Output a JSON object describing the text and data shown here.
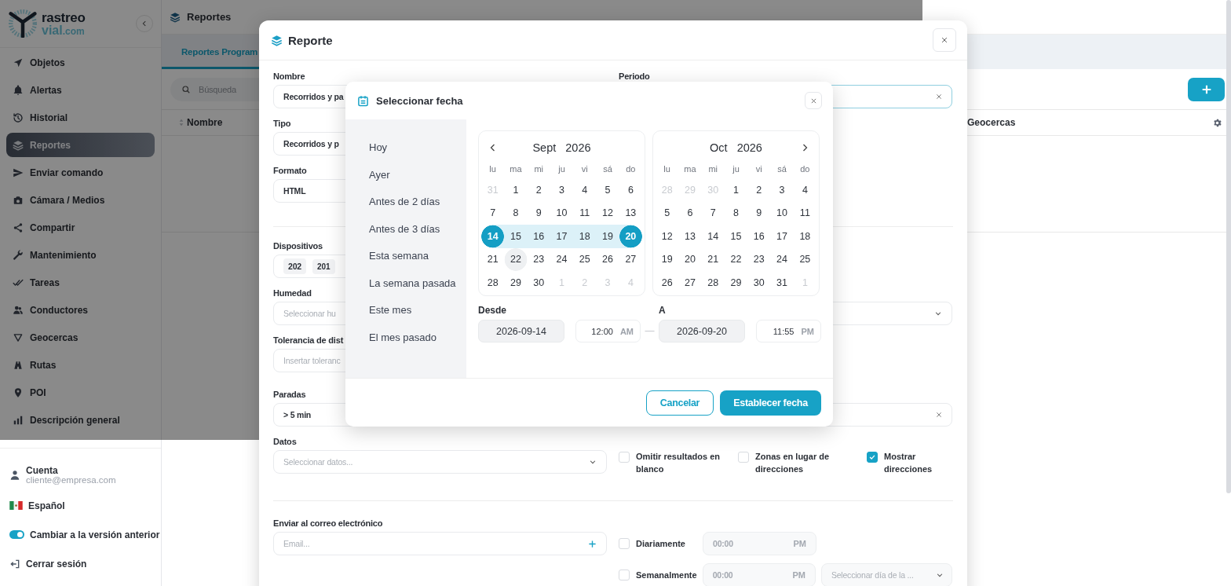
{
  "sidebar": {
    "brand": {
      "name": "rastreo",
      "domain": "vial",
      "tld": ".com"
    },
    "items": [
      {
        "label": "Objetos",
        "selected": false
      },
      {
        "label": "Alertas",
        "selected": false
      },
      {
        "label": "Historial",
        "selected": false
      },
      {
        "label": "Reportes",
        "selected": true
      },
      {
        "label": "Enviar comando",
        "selected": false
      },
      {
        "label": "Cámara / Medios",
        "selected": false
      },
      {
        "label": "Compartir",
        "selected": false
      },
      {
        "label": "Mantenimiento",
        "selected": false
      },
      {
        "label": "Tareas",
        "selected": false
      },
      {
        "label": "Conductores",
        "selected": false
      },
      {
        "label": "Geocercas",
        "selected": false
      },
      {
        "label": "Rutas",
        "selected": false
      },
      {
        "label": "POI",
        "selected": false
      },
      {
        "label": "Descripción general",
        "selected": false
      }
    ],
    "account": {
      "label": "Cuenta",
      "email": "cliente@empresa.com"
    },
    "language": "Español",
    "legacy_toggle": {
      "label": "Cambiar a la versión anterior",
      "on": true
    },
    "logout": "Cerrar sesión"
  },
  "page": {
    "title": "Reportes",
    "tabs": [
      {
        "label": "Reportes Program",
        "selected": true
      }
    ],
    "search": {
      "placeholder": "Búsqueda"
    },
    "table": {
      "columns": [
        "Nombre",
        "Geocercas"
      ]
    }
  },
  "report_dialog": {
    "title": "Reporte",
    "nombre": {
      "label": "Nombre",
      "value": "Recorridos y pa"
    },
    "periodo": {
      "label": "Periodo"
    },
    "tipo": {
      "label": "Tipo",
      "value": "Recorridos y p"
    },
    "formato": {
      "label": "Formato",
      "value": "HTML"
    },
    "dispositivos": {
      "label": "Dispositivos",
      "chips": [
        "202",
        "201"
      ]
    },
    "humedad": {
      "label": "Humedad",
      "placeholder": "Seleccionar hu"
    },
    "tolerancia": {
      "label": "Tolerancia de dist",
      "placeholder": "Insertar toleranc"
    },
    "paradas": {
      "label": "Paradas",
      "value": "> 5 min"
    },
    "datos": {
      "label": "Datos",
      "placeholder": "Seleccionar datos..."
    },
    "options": [
      {
        "label": "Omitir resultados en blanco",
        "checked": false
      },
      {
        "label": "Zonas en lugar de direcciones",
        "checked": false
      },
      {
        "label": "Mostrar direcciones",
        "checked": true
      }
    ],
    "email": {
      "label": "Enviar al correo electrónico",
      "placeholder": "Email..."
    },
    "schedule": [
      {
        "label": "Diariamente",
        "checked": false,
        "time": "00:00",
        "meridiem": "PM"
      },
      {
        "label": "Semanalmente",
        "checked": false,
        "time": "00:00",
        "meridiem": "PM",
        "day_placeholder": "Seleccionar día de la ..."
      }
    ]
  },
  "date_dialog": {
    "title": "Seleccionar fecha",
    "presets": [
      "Hoy",
      "Ayer",
      "Antes de 2 días",
      "Antes de 3 días",
      "Esta semana",
      "La semana pasada",
      "Este mes",
      "El mes pasado"
    ],
    "months": [
      {
        "month": "Sept",
        "year": "2026",
        "weekdays": [
          "lu",
          "ma",
          "mi",
          "ju",
          "vi",
          "sá",
          "do"
        ],
        "days": [
          {
            "label": "31",
            "muted": true,
            "selected": false,
            "in_range": false,
            "hovered": false
          },
          {
            "label": "1",
            "muted": false,
            "selected": false,
            "in_range": false,
            "hovered": false
          },
          {
            "label": "2",
            "muted": false,
            "selected": false,
            "in_range": false,
            "hovered": false
          },
          {
            "label": "3",
            "muted": false,
            "selected": false,
            "in_range": false,
            "hovered": false
          },
          {
            "label": "4",
            "muted": false,
            "selected": false,
            "in_range": false,
            "hovered": false
          },
          {
            "label": "5",
            "muted": false,
            "selected": false,
            "in_range": false,
            "hovered": false
          },
          {
            "label": "6",
            "muted": false,
            "selected": false,
            "in_range": false,
            "hovered": false
          },
          {
            "label": "7",
            "muted": false,
            "selected": false,
            "in_range": false,
            "hovered": false
          },
          {
            "label": "8",
            "muted": false,
            "selected": false,
            "in_range": false,
            "hovered": false
          },
          {
            "label": "9",
            "muted": false,
            "selected": false,
            "in_range": false,
            "hovered": false
          },
          {
            "label": "10",
            "muted": false,
            "selected": false,
            "in_range": false,
            "hovered": false
          },
          {
            "label": "11",
            "muted": false,
            "selected": false,
            "in_range": false,
            "hovered": false
          },
          {
            "label": "12",
            "muted": false,
            "selected": false,
            "in_range": false,
            "hovered": false
          },
          {
            "label": "13",
            "muted": false,
            "selected": false,
            "in_range": false,
            "hovered": false
          },
          {
            "label": "14",
            "muted": false,
            "selected": true,
            "in_range": false,
            "hovered": false
          },
          {
            "label": "15",
            "muted": false,
            "selected": false,
            "in_range": true,
            "hovered": false
          },
          {
            "label": "16",
            "muted": false,
            "selected": false,
            "in_range": true,
            "hovered": false
          },
          {
            "label": "17",
            "muted": false,
            "selected": false,
            "in_range": true,
            "hovered": false
          },
          {
            "label": "18",
            "muted": false,
            "selected": false,
            "in_range": true,
            "hovered": false
          },
          {
            "label": "19",
            "muted": false,
            "selected": false,
            "in_range": true,
            "hovered": false
          },
          {
            "label": "20",
            "muted": false,
            "selected": true,
            "in_range": false,
            "hovered": false
          },
          {
            "label": "21",
            "muted": false,
            "selected": false,
            "in_range": false,
            "hovered": false
          },
          {
            "label": "22",
            "muted": false,
            "selected": false,
            "in_range": false,
            "hovered": true
          },
          {
            "label": "23",
            "muted": false,
            "selected": false,
            "in_range": false,
            "hovered": false
          },
          {
            "label": "24",
            "muted": false,
            "selected": false,
            "in_range": false,
            "hovered": false
          },
          {
            "label": "25",
            "muted": false,
            "selected": false,
            "in_range": false,
            "hovered": false
          },
          {
            "label": "26",
            "muted": false,
            "selected": false,
            "in_range": false,
            "hovered": false
          },
          {
            "label": "27",
            "muted": false,
            "selected": false,
            "in_range": false,
            "hovered": false
          },
          {
            "label": "28",
            "muted": false,
            "selected": false,
            "in_range": false,
            "hovered": false
          },
          {
            "label": "29",
            "muted": false,
            "selected": false,
            "in_range": false,
            "hovered": false
          },
          {
            "label": "30",
            "muted": false,
            "selected": false,
            "in_range": false,
            "hovered": false
          },
          {
            "label": "1",
            "muted": true,
            "selected": false,
            "in_range": false,
            "hovered": false
          },
          {
            "label": "2",
            "muted": true,
            "selected": false,
            "in_range": false,
            "hovered": false
          },
          {
            "label": "3",
            "muted": true,
            "selected": false,
            "in_range": false,
            "hovered": false
          },
          {
            "label": "4",
            "muted": true,
            "selected": false,
            "in_range": false,
            "hovered": false
          }
        ]
      },
      {
        "month": "Oct",
        "year": "2026",
        "weekdays": [
          "lu",
          "ma",
          "mi",
          "ju",
          "vi",
          "sá",
          "do"
        ],
        "days": [
          {
            "label": "28",
            "muted": true,
            "selected": false,
            "in_range": false,
            "hovered": false
          },
          {
            "label": "29",
            "muted": true,
            "selected": false,
            "in_range": false,
            "hovered": false
          },
          {
            "label": "30",
            "muted": true,
            "selected": false,
            "in_range": false,
            "hovered": false
          },
          {
            "label": "1",
            "muted": false,
            "selected": false,
            "in_range": false,
            "hovered": false
          },
          {
            "label": "2",
            "muted": false,
            "selected": false,
            "in_range": false,
            "hovered": false
          },
          {
            "label": "3",
            "muted": false,
            "selected": false,
            "in_range": false,
            "hovered": false
          },
          {
            "label": "4",
            "muted": false,
            "selected": false,
            "in_range": false,
            "hovered": false
          },
          {
            "label": "5",
            "muted": false,
            "selected": false,
            "in_range": false,
            "hovered": false
          },
          {
            "label": "6",
            "muted": false,
            "selected": false,
            "in_range": false,
            "hovered": false
          },
          {
            "label": "7",
            "muted": false,
            "selected": false,
            "in_range": false,
            "hovered": false
          },
          {
            "label": "8",
            "muted": false,
            "selected": false,
            "in_range": false,
            "hovered": false
          },
          {
            "label": "9",
            "muted": false,
            "selected": false,
            "in_range": false,
            "hovered": false
          },
          {
            "label": "10",
            "muted": false,
            "selected": false,
            "in_range": false,
            "hovered": false
          },
          {
            "label": "11",
            "muted": false,
            "selected": false,
            "in_range": false,
            "hovered": false
          },
          {
            "label": "12",
            "muted": false,
            "selected": false,
            "in_range": false,
            "hovered": false
          },
          {
            "label": "13",
            "muted": false,
            "selected": false,
            "in_range": false,
            "hovered": false
          },
          {
            "label": "14",
            "muted": false,
            "selected": false,
            "in_range": false,
            "hovered": false
          },
          {
            "label": "15",
            "muted": false,
            "selected": false,
            "in_range": false,
            "hovered": false
          },
          {
            "label": "16",
            "muted": false,
            "selected": false,
            "in_range": false,
            "hovered": false
          },
          {
            "label": "17",
            "muted": false,
            "selected": false,
            "in_range": false,
            "hovered": false
          },
          {
            "label": "18",
            "muted": false,
            "selected": false,
            "in_range": false,
            "hovered": false
          },
          {
            "label": "19",
            "muted": false,
            "selected": false,
            "in_range": false,
            "hovered": false
          },
          {
            "label": "20",
            "muted": false,
            "selected": false,
            "in_range": false,
            "hovered": false
          },
          {
            "label": "21",
            "muted": false,
            "selected": false,
            "in_range": false,
            "hovered": false
          },
          {
            "label": "22",
            "muted": false,
            "selected": false,
            "in_range": false,
            "hovered": false
          },
          {
            "label": "23",
            "muted": false,
            "selected": false,
            "in_range": false,
            "hovered": false
          },
          {
            "label": "24",
            "muted": false,
            "selected": false,
            "in_range": false,
            "hovered": false
          },
          {
            "label": "25",
            "muted": false,
            "selected": false,
            "in_range": false,
            "hovered": false
          },
          {
            "label": "26",
            "muted": false,
            "selected": false,
            "in_range": false,
            "hovered": false
          },
          {
            "label": "27",
            "muted": false,
            "selected": false,
            "in_range": false,
            "hovered": false
          },
          {
            "label": "28",
            "muted": false,
            "selected": false,
            "in_range": false,
            "hovered": false
          },
          {
            "label": "29",
            "muted": false,
            "selected": false,
            "in_range": false,
            "hovered": false
          },
          {
            "label": "30",
            "muted": false,
            "selected": false,
            "in_range": false,
            "hovered": false
          },
          {
            "label": "31",
            "muted": false,
            "selected": false,
            "in_range": false,
            "hovered": false
          },
          {
            "label": "1",
            "muted": true,
            "selected": false,
            "in_range": false,
            "hovered": false
          }
        ]
      }
    ],
    "from": {
      "label": "Desde",
      "date": "2026-09-14",
      "time": "12:00",
      "meridiem": "AM"
    },
    "separator": "—",
    "to": {
      "label": "A",
      "date": "2026-09-20",
      "time": "11:55",
      "meridiem": "PM"
    },
    "buttons": {
      "cancel": "Cancelar",
      "confirm": "Establecer fecha"
    }
  }
}
